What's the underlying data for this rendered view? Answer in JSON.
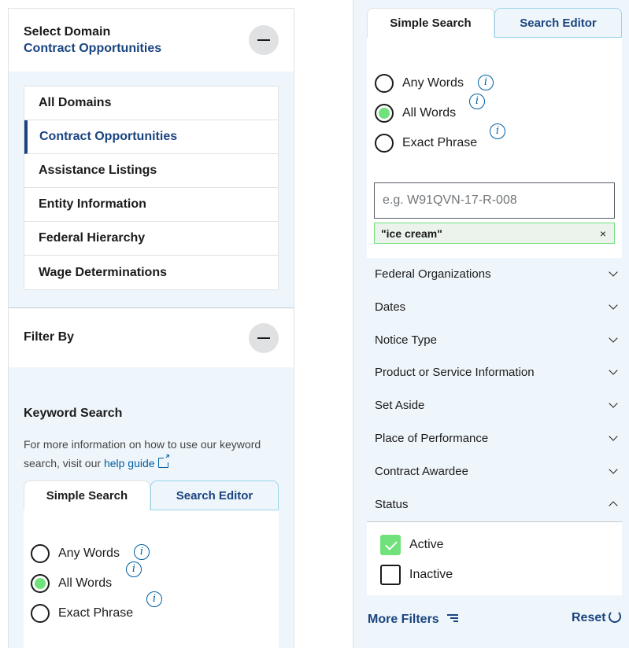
{
  "left": {
    "domain_header": {
      "label": "Select Domain",
      "value": "Contract Opportunities"
    },
    "domains": [
      {
        "label": "All Domains"
      },
      {
        "label": "Contract Opportunities",
        "selected": true
      },
      {
        "label": "Assistance Listings"
      },
      {
        "label": "Entity Information"
      },
      {
        "label": "Federal Hierarchy"
      },
      {
        "label": "Wage Determinations"
      }
    ],
    "filter_header": "Filter By",
    "keyword": {
      "title": "Keyword Search",
      "help_text": "For more information on how to use our keyword search, visit our",
      "help_link": "help guide"
    },
    "tabs": {
      "simple": "Simple Search",
      "editor": "Search Editor"
    },
    "radios": {
      "any": "Any Words",
      "all": "All Words",
      "exact": "Exact Phrase"
    }
  },
  "right": {
    "tabs": {
      "simple": "Simple Search",
      "editor": "Search Editor"
    },
    "radios": {
      "any": "Any Words",
      "all": "All Words",
      "exact": "Exact Phrase"
    },
    "selected_radio": "All Words",
    "input_placeholder": "e.g. W91QVN-17-R-008",
    "tag": {
      "text": "\"ice cream\"",
      "remove": "×"
    },
    "accordions": [
      "Federal Organizations",
      "Dates",
      "Notice Type",
      "Product or Service Information",
      "Set Aside",
      "Place of Performance",
      "Contract Awardee",
      "Status"
    ],
    "status_options": [
      {
        "label": "Active",
        "checked": true
      },
      {
        "label": "Inactive",
        "checked": false
      }
    ],
    "more_filters": "More Filters",
    "reset": "Reset"
  },
  "colors": {
    "primary": "#1a4480",
    "link": "#005ea2",
    "checked": "#70e17b",
    "panel_bg": "#eff6fb"
  },
  "icons": [
    "minus-icon",
    "info-icon",
    "external-link-icon",
    "chevron-down-icon",
    "chevron-up-icon",
    "close-icon",
    "checkmark-icon",
    "filter-lines-icon",
    "reset-icon"
  ]
}
